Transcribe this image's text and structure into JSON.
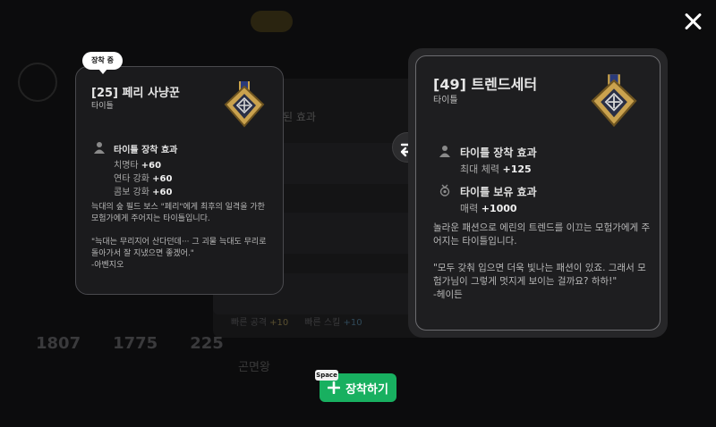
{
  "close_label": "×",
  "equip_badge": "장착 중",
  "current_title": {
    "name": "[25] 페리 사냥꾼",
    "type": "타이틀",
    "effect_header": "타이틀 장착 효과",
    "effects": [
      {
        "label": "치명타",
        "value": "+60"
      },
      {
        "label": "연타 강화",
        "value": "+60"
      },
      {
        "label": "콤보 강화",
        "value": "+60"
      }
    ],
    "description": "늑대의 숲 필드 보스 \"페리\"에게 최후의 일격을 가한 모험가에게 주어지는 타이틀입니다.\n\n\"늑대는 무리지어 산다던데··· 그 괴물 늑대도 무리로 돌아가서 잘 지냈으면 좋겠어.\"\n-아벤지오"
  },
  "new_title": {
    "name": "[49] 트렌드세터",
    "type": "타이틀",
    "equip_header": "타이틀 장착 효과",
    "equip_effect": {
      "label": "최대 체력",
      "value": "+125"
    },
    "own_header": "타이틀 보유 효과",
    "own_effect": {
      "label": "매력",
      "value": "+1000"
    },
    "description": "놀라운 패션으로 에린의 트렌드를 이끄는 모험가에게 주어지는 타이틀입니다.\n\n\"모두 갖춰 입으면 더욱 빛나는 패션이 있죠. 그래서 모험가님이 그렇게 멋지게 보이는 걸까요? 하하!\"\n-헤이든"
  },
  "equip_button": {
    "label": "장착하기",
    "shortcut": "Space"
  },
  "background": {
    "partial_heading": "된 효과",
    "stats": [
      "1807",
      "1775",
      "225"
    ],
    "buffs": [
      {
        "label": "빠른 공격",
        "value": "+10"
      },
      {
        "label": "빠른 스킬",
        "value": "+10"
      }
    ],
    "list_items": [
      "곤면왕"
    ]
  },
  "colors": {
    "accent_green": "#18b060",
    "overlay_bg": "#0c0c0d"
  }
}
